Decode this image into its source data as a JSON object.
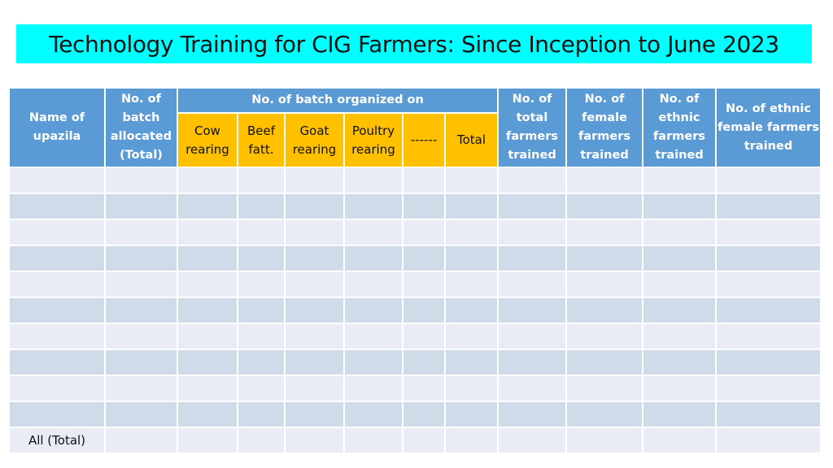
{
  "title": "Technology Training for CIG Farmers: Since Inception to June 2023",
  "colors": {
    "title_bg": "#00ffff",
    "header_blue": "#5b9bd5",
    "header_gold": "#ffc000",
    "row_light": "#e9ecf5",
    "row_dark": "#d0dbea"
  },
  "table": {
    "headers": {
      "upazila": "Name of upazila",
      "batch_allocated": "No. of batch allocated (Total)",
      "batch_organized_group": "No. of batch organized on",
      "sub": [
        "Cow rearing",
        "Beef fatt.",
        "Goat rearing",
        "Poultry rearing",
        "------",
        "Total"
      ],
      "total_farmers": "No. of total farmers trained",
      "female_farmers": "No. of female farmers trained",
      "ethnic_farmers": "No. of ethnic farmers trained",
      "ethnic_female_farmers": "No. of ethnic female farmers trained"
    },
    "rows": [
      {
        "label": "",
        "cells": [
          "",
          "",
          "",
          "",
          "",
          "",
          "",
          "",
          "",
          "",
          ""
        ]
      },
      {
        "label": "",
        "cells": [
          "",
          "",
          "",
          "",
          "",
          "",
          "",
          "",
          "",
          "",
          ""
        ]
      },
      {
        "label": "",
        "cells": [
          "",
          "",
          "",
          "",
          "",
          "",
          "",
          "",
          "",
          "",
          ""
        ]
      },
      {
        "label": "",
        "cells": [
          "",
          "",
          "",
          "",
          "",
          "",
          "",
          "",
          "",
          "",
          ""
        ]
      },
      {
        "label": "",
        "cells": [
          "",
          "",
          "",
          "",
          "",
          "",
          "",
          "",
          "",
          "",
          ""
        ]
      },
      {
        "label": "",
        "cells": [
          "",
          "",
          "",
          "",
          "",
          "",
          "",
          "",
          "",
          "",
          ""
        ]
      },
      {
        "label": "",
        "cells": [
          "",
          "",
          "",
          "",
          "",
          "",
          "",
          "",
          "",
          "",
          ""
        ]
      },
      {
        "label": "",
        "cells": [
          "",
          "",
          "",
          "",
          "",
          "",
          "",
          "",
          "",
          "",
          ""
        ]
      },
      {
        "label": "",
        "cells": [
          "",
          "",
          "",
          "",
          "",
          "",
          "",
          "",
          "",
          "",
          ""
        ]
      },
      {
        "label": "",
        "cells": [
          "",
          "",
          "",
          "",
          "",
          "",
          "",
          "",
          "",
          "",
          ""
        ]
      },
      {
        "label": "All (Total)",
        "cells": [
          "",
          "",
          "",
          "",
          "",
          "",
          "",
          "",
          "",
          "",
          ""
        ]
      }
    ]
  }
}
